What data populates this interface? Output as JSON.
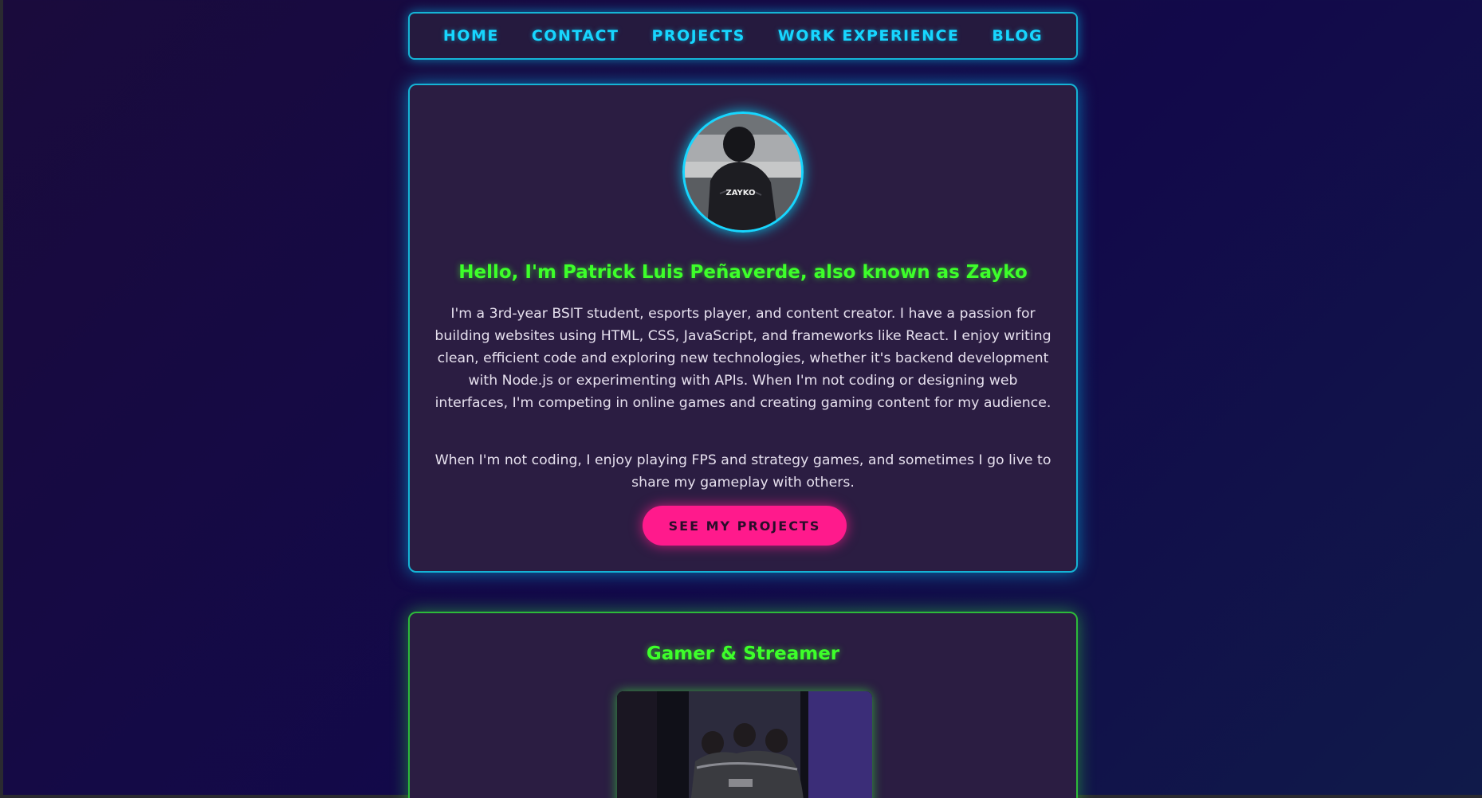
{
  "nav": {
    "items": [
      "HOME",
      "CONTACT",
      "PROJECTS",
      "WORK EXPERIENCE",
      "BLOG"
    ]
  },
  "about": {
    "avatar_jersey_text": "ZAYKO",
    "title": "Hello, I'm Patrick Luis Peñaverde, also known as Zayko",
    "paragraph1": "I'm a 3rd-year BSIT student, esports player, and content creator. I have a passion for building websites using HTML, CSS, JavaScript, and frameworks like React. I enjoy writing clean, efficient code and exploring new technologies, whether it's backend development with Node.js or experimenting with APIs. When I'm not coding or designing web interfaces, I'm competing in online games and creating gaming content for my audience.",
    "paragraph2": "When I'm not coding, I enjoy playing FPS and strategy games, and sometimes I go live to share my gameplay with others.",
    "cta_label": "SEE MY PROJECTS"
  },
  "gamer": {
    "title": "Gamer & Streamer"
  },
  "colors": {
    "cyan_accent": "#17d6ff",
    "green_accent": "#3dff2a",
    "pink_button": "#ff1a8c",
    "card_bg": "#2b1d42"
  }
}
